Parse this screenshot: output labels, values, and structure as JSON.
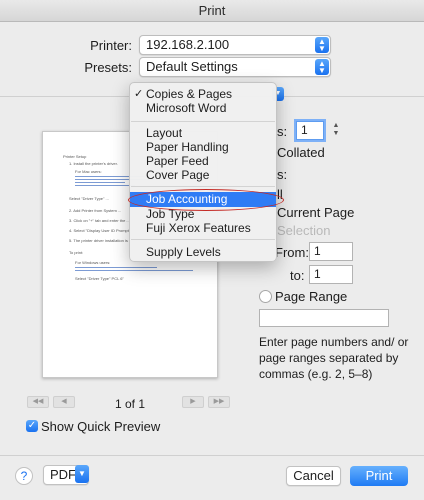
{
  "window": {
    "title": "Print"
  },
  "printer": {
    "label": "Printer:",
    "value": "192.168.2.100"
  },
  "presets": {
    "label": "Presets:",
    "value": "Default Settings"
  },
  "menu": {
    "items": [
      {
        "label": "Copies & Pages",
        "checked": true
      },
      {
        "label": "Microsoft Word"
      },
      {
        "label": "Layout"
      },
      {
        "label": "Paper Handling"
      },
      {
        "label": "Paper Feed"
      },
      {
        "label": "Cover Page"
      },
      {
        "label": "Job Accounting",
        "selected": true
      },
      {
        "label": "Job Type"
      },
      {
        "label": "Fuji Xerox Features"
      },
      {
        "label": "Supply Levels"
      }
    ],
    "check_glyph": "✓"
  },
  "copies": {
    "label_fragment": "s:",
    "value": "1",
    "collated_label": "Collated"
  },
  "pages": {
    "label_fragment": "s:",
    "all_fragment": "ll",
    "current_page": "Current Page",
    "selection": "Selection",
    "from_label": "From:",
    "from_value": "1",
    "to_label": "to:",
    "to_value": "1",
    "page_range": "Page Range",
    "help": "Enter page numbers and/ or page ranges separated by commas (e.g. 2, 5–8)"
  },
  "preview": {
    "page_indicator": "1 of 1",
    "show_quick_preview": "Show Quick Preview",
    "doc": {
      "heading": "Printer Setup",
      "step1": "1. Install the printer's driver.",
      "mac_users": "For Mac users:",
      "select1": "Select \"Driver Type\" ...",
      "step2": "2. Add Printer from System ...",
      "step3": "3. Click on \"+\" tab and enter the ...",
      "step4": "4. Select \"Display User ID Prompt\" ...",
      "step5": "5. The printer driver installation is ...",
      "to_print": "To print:",
      "windows_users": "For Windows users:",
      "select2": "Select \"Driver Type\" PCL 6\""
    }
  },
  "buttons": {
    "help": "?",
    "pdf": "PDF",
    "cancel": "Cancel",
    "print": "Print"
  },
  "colors": {
    "accent": "#1f7bf4",
    "selection": "#2f7cf5",
    "annotation": "#c42a25"
  }
}
